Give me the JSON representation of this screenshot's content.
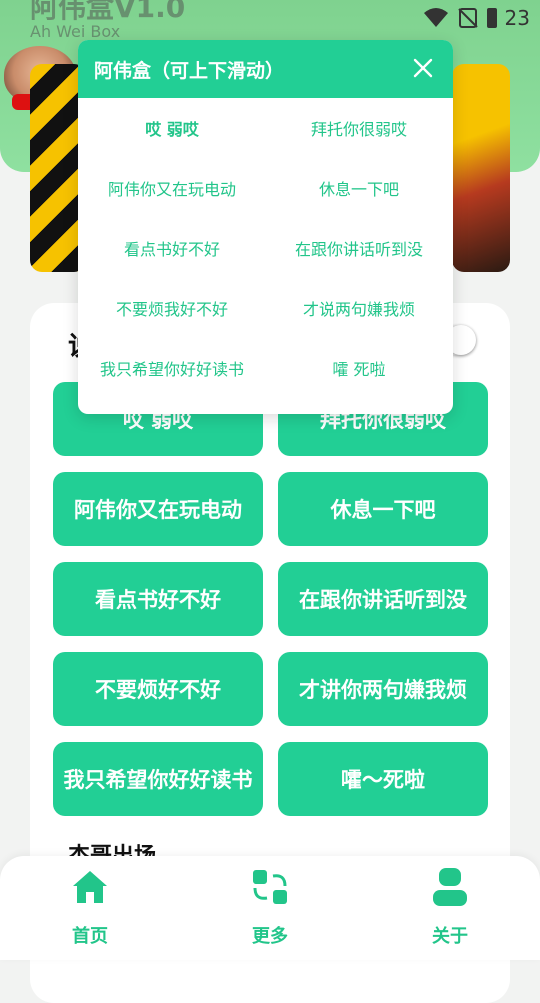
{
  "app": {
    "title": "阿伟盒V1.0",
    "subtitle": "Ah Wei Box"
  },
  "status": {
    "time": "23"
  },
  "theme": {
    "accent": "#22cf95",
    "header": "#8fe0a0"
  },
  "popup": {
    "title": "阿伟盒（可上下滑动）",
    "items": [
      "哎 弱哎",
      "拜托你很弱哎",
      "阿伟你又在玩电动",
      "休息一下吧",
      "看点书好不好",
      "在跟你讲话听到没",
      "不要烦我好不好",
      "才说两句嫌我烦",
      "我只希望你好好读书",
      "嚯 死啦"
    ]
  },
  "section": {
    "partial_title": "说",
    "next_title": "杰哥出场"
  },
  "buttons": [
    "哎 弱哎",
    "拜托你很弱哎",
    "阿伟你又在玩电动",
    "休息一下吧",
    "看点书好不好",
    "在跟你讲话听到没",
    "不要烦好不好",
    "才讲你两句嫌我烦",
    "我只希望你好好读书",
    "嚯～死啦"
  ],
  "nav": {
    "home": "首页",
    "more": "更多",
    "about": "关于"
  }
}
